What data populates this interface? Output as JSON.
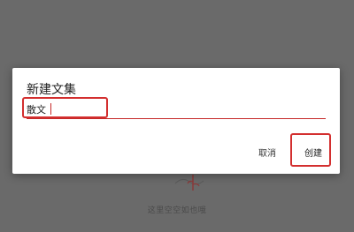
{
  "background": {
    "empty_text": "这里空空如也哦"
  },
  "dialog": {
    "title": "新建文集",
    "input": {
      "value": "散文",
      "placeholder": ""
    },
    "cancel_label": "取消",
    "create_label": "创建"
  },
  "colors": {
    "accent": "#c62828",
    "highlight": "#d32f2f",
    "overlay": "#6a6a6a"
  }
}
